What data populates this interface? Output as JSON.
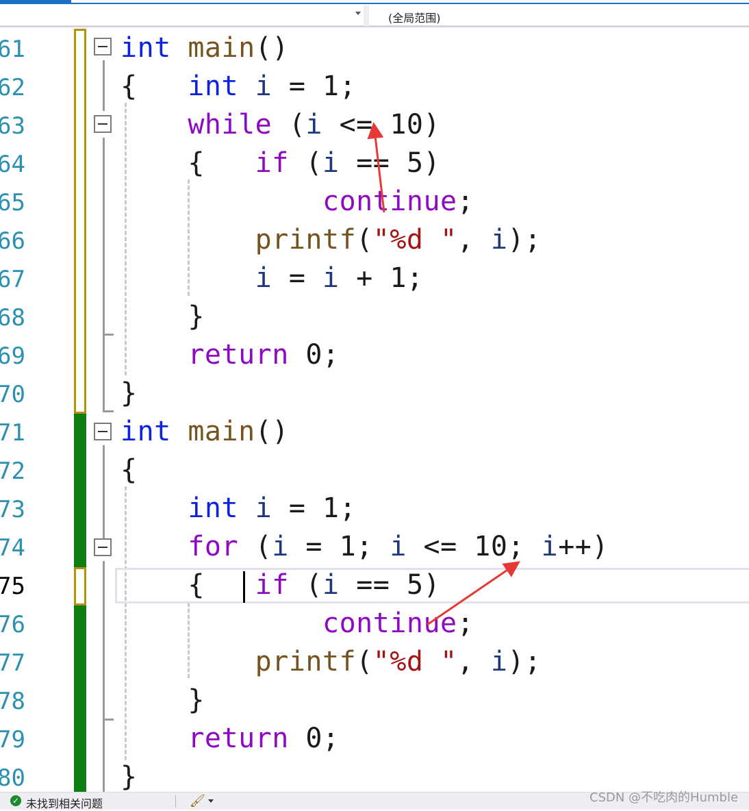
{
  "nav": {
    "scope_label": "(全局范围)"
  },
  "line_numbers": [
    "61",
    "62",
    "63",
    "64",
    "65",
    "66",
    "67",
    "68",
    "69",
    "70",
    "71",
    "72",
    "73",
    "74",
    "75",
    "76",
    "77",
    "78",
    "79",
    "80"
  ],
  "current_line": "75",
  "code": {
    "l61": {
      "kw": "int",
      "fn": "main",
      "rest": "()"
    },
    "l62": {
      "brace": "{",
      "kw": "int",
      "var": "i",
      "rest": " = 1;"
    },
    "l63": {
      "kw": "while",
      "rest1": " (",
      "var": "i",
      "rest2": " <= 10)"
    },
    "l64": {
      "brace": "{",
      "kw": "if",
      "rest1": " (",
      "var": "i",
      "rest2": " == 5)"
    },
    "l65": {
      "kw": "continue",
      "rest": ";"
    },
    "l66": {
      "fn": "printf",
      "p1": "(",
      "str": "\"%d \"",
      "p2": ", ",
      "var": "i",
      "p3": ");"
    },
    "l67": {
      "var1": "i",
      "rest1": " = ",
      "var2": "i",
      "rest2": " + 1;"
    },
    "l68": {
      "brace": "}"
    },
    "l69": {
      "kw": "return",
      "rest": " 0;"
    },
    "l70": {
      "brace": "}"
    },
    "l71": {
      "kw": "int",
      "fn": "main",
      "rest": "()"
    },
    "l72": {
      "brace": "{"
    },
    "l73": {
      "kw": "int",
      "var": "i",
      "rest": " = 1;"
    },
    "l74": {
      "kw": "for",
      "rest1": " (",
      "var1": "i",
      "rest2": " = 1; ",
      "var2": "i",
      "rest3": " <= 10; ",
      "var3": "i",
      "rest4": "++)"
    },
    "l75": {
      "brace": "{",
      "kw": "if",
      "rest1": " (",
      "var": "i",
      "rest2": " == 5)"
    },
    "l76": {
      "kw": "continue",
      "rest": ";"
    },
    "l77": {
      "fn": "printf",
      "p1": "(",
      "str": "\"%d \"",
      "p2": ", ",
      "var": "i",
      "p3": ");"
    },
    "l78": {
      "brace": "}"
    },
    "l79": {
      "kw": "return",
      "rest": " 0;"
    },
    "l80": {
      "brace": "}"
    }
  },
  "status": {
    "text": "未找到相关问题",
    "icon": "check-circle-icon"
  },
  "watermark": "CSDN @不吃肉的Humble",
  "colors": {
    "keyword_blue": "#0b22e0",
    "keyword_purple": "#8f08c4",
    "function": "#74531f",
    "string": "#a31515",
    "change_saved": "#0f7d16",
    "change_unsaved": "#b8900a",
    "annotation_arrow": "#e53935"
  }
}
